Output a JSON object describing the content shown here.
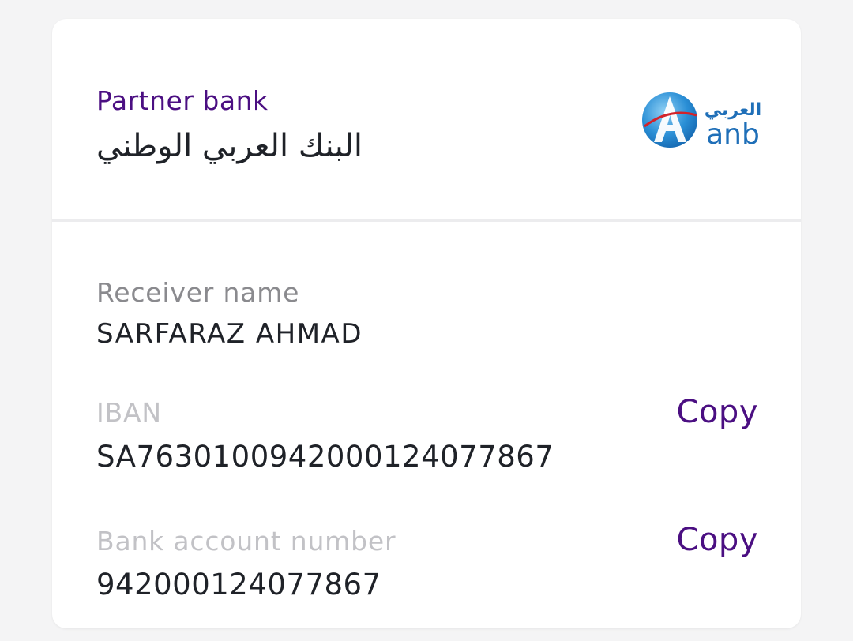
{
  "partner": {
    "label": "Partner bank",
    "bank_name": "البنك العربي الوطني",
    "logo": {
      "arabic_text": "العربي",
      "latin_text": "anb",
      "colors": {
        "globe": "#2a8fd6",
        "text": "#1f6fb8",
        "swoosh": "#d2232a"
      }
    }
  },
  "receiver": {
    "label": "Receiver name",
    "value": "SARFARAZ AHMAD"
  },
  "iban": {
    "label": "IBAN",
    "value": "SA7630100942000124077867",
    "copy_label": "Copy"
  },
  "account": {
    "label": "Bank account number",
    "value": "942000124077867",
    "copy_label": "Copy"
  },
  "colors": {
    "accent": "#4b0f82",
    "text": "#1f2228",
    "muted": "#8a8a8e",
    "faint": "#c2c2c6"
  }
}
